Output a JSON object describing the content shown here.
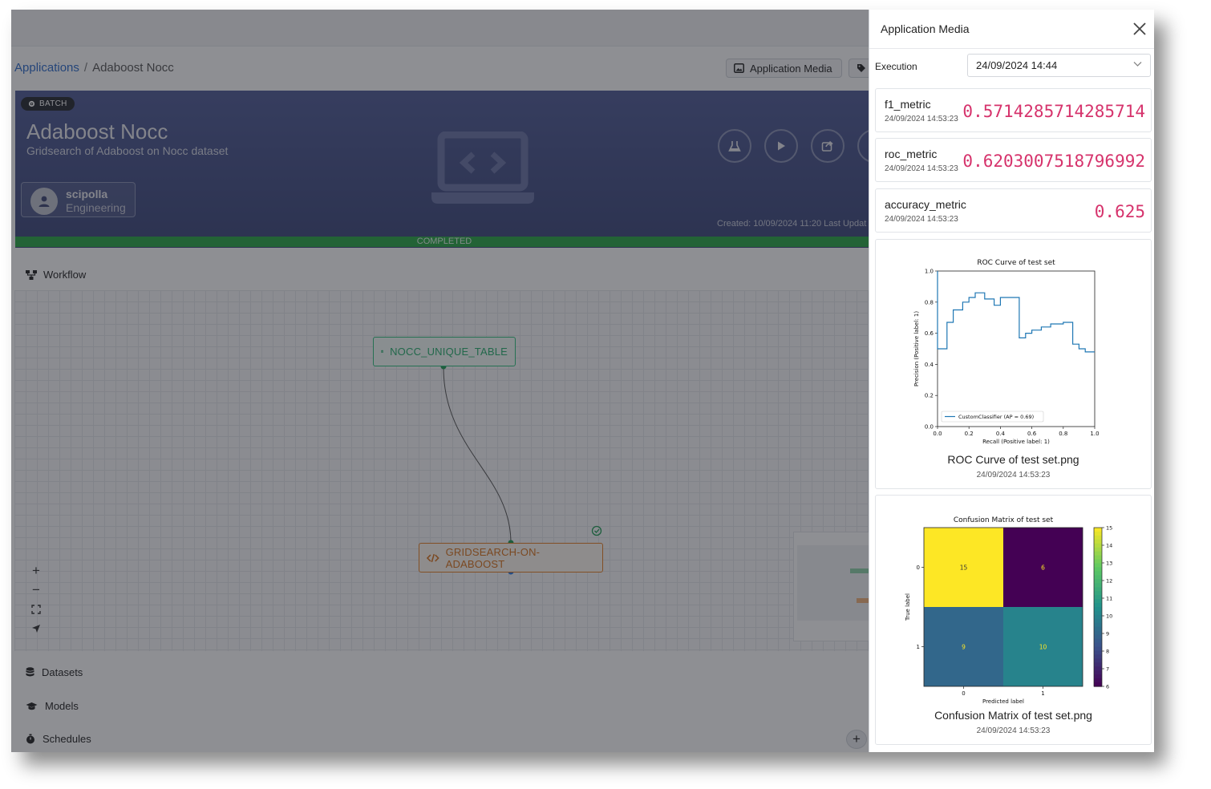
{
  "breadcrumb": {
    "root": "Applications",
    "separator": "/",
    "current": "Adaboost Nocc"
  },
  "header_buttons": {
    "media": "Application Media"
  },
  "hero": {
    "badge": "BATCH",
    "title": "Adaboost Nocc",
    "subtitle": "Gridsearch of Adaboost on Nocc dataset",
    "user": {
      "name": "scipolla",
      "department": "Engineering"
    },
    "created": "Created: 10/09/2024 11:20   Last Updat",
    "status": "COMPLETED"
  },
  "workflow": {
    "label": "Workflow",
    "nodes": {
      "dataset": "NOCC_UNIQUE_TABLE",
      "code": "GRIDSEARCH-ON-ADABOOST"
    },
    "zoom": {
      "in": "+",
      "out": "−"
    }
  },
  "sections": {
    "datasets": "Datasets",
    "models": "Models",
    "schedules": "Schedules",
    "add": "+"
  },
  "panel": {
    "title": "Application Media",
    "execution_label": "Execution",
    "execution_value": "24/09/2024 14:44",
    "metrics": [
      {
        "name": "f1_metric",
        "time": "24/09/2024 14:53:23",
        "value": "0.5714285714285714"
      },
      {
        "name": "roc_metric",
        "time": "24/09/2024 14:53:23",
        "value": "0.6203007518796992"
      },
      {
        "name": "accuracy_metric",
        "time": "24/09/2024 14:53:23",
        "value": "0.625"
      }
    ],
    "media": [
      {
        "caption": "ROC Curve of test set.png",
        "time": "24/09/2024 14:53:23"
      },
      {
        "caption": "Confusion Matrix of test set.png",
        "time": "24/09/2024 14:53:23"
      }
    ]
  },
  "chart_data": [
    {
      "type": "line",
      "title": "ROC Curve of test set",
      "xlabel": "Recall (Positive label: 1)",
      "ylabel": "Precision (Positive label: 1)",
      "xlim": [
        0.0,
        1.0
      ],
      "ylim": [
        0.0,
        1.0
      ],
      "xticks": [
        "0.0",
        "0.2",
        "0.4",
        "0.6",
        "0.8",
        "1.0"
      ],
      "yticks": [
        "0.0",
        "0.2",
        "0.4",
        "0.6",
        "0.8",
        "1.0"
      ],
      "legend_position": "bottom-left",
      "color": "#1f77b4",
      "series": [
        {
          "name": "CustomClassifier (AP = 0.69)",
          "x": [
            0.0,
            0.0,
            0.06,
            0.06,
            0.1,
            0.1,
            0.16,
            0.16,
            0.2,
            0.2,
            0.24,
            0.24,
            0.3,
            0.3,
            0.36,
            0.36,
            0.4,
            0.4,
            0.46,
            0.46,
            0.52,
            0.52,
            0.56,
            0.56,
            0.6,
            0.6,
            0.66,
            0.66,
            0.72,
            0.72,
            0.8,
            0.8,
            0.86,
            0.86,
            0.9,
            0.9,
            0.94,
            0.94,
            1.0
          ],
          "y": [
            1.0,
            0.5,
            0.5,
            0.67,
            0.67,
            0.75,
            0.75,
            0.8,
            0.8,
            0.83,
            0.83,
            0.86,
            0.86,
            0.82,
            0.82,
            0.78,
            0.78,
            0.83,
            0.83,
            0.83,
            0.83,
            0.57,
            0.57,
            0.6,
            0.6,
            0.62,
            0.62,
            0.64,
            0.64,
            0.66,
            0.66,
            0.67,
            0.67,
            0.53,
            0.53,
            0.5,
            0.5,
            0.48,
            0.48
          ]
        }
      ]
    },
    {
      "type": "heatmap",
      "title": "Confusion Matrix of test set",
      "xlabel": "Predicted label",
      "ylabel": "True label",
      "x_categories": [
        "0",
        "1"
      ],
      "y_categories": [
        "0",
        "1"
      ],
      "values": [
        [
          15,
          6
        ],
        [
          9,
          10
        ]
      ],
      "colorbar": {
        "min": 6,
        "max": 15,
        "ticks": [
          "6",
          "7",
          "8",
          "9",
          "10",
          "11",
          "12",
          "13",
          "14",
          "15"
        ]
      }
    }
  ]
}
